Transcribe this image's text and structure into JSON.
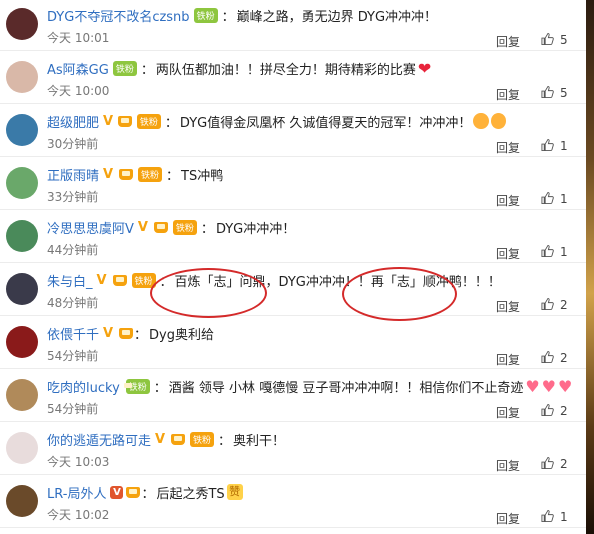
{
  "comments": [
    {
      "user": "DYG不夺冠不改名czsnb",
      "badge": "铁粉",
      "badge_color": "#8ec63f",
      "text": "巅峰之路，勇无边界 DYG冲冲冲！",
      "time": "今天 10:01",
      "reply": "回复",
      "likes": "5",
      "avatar_color": "#5a2a2a"
    },
    {
      "user": "As阿森GG",
      "badge": "铁粉",
      "badge_color": "#8ec63f",
      "text": "两队伍都加油！！拼尽全力！期待精彩的比赛",
      "time": "今天 10:00",
      "reply": "回复",
      "likes": "5",
      "avatar_color": "#d9b8a8"
    },
    {
      "user": "超级肥肥",
      "badge": "铁粉",
      "badge_color": "#f5a20e",
      "text": "DYG值得金凤凰杯 久诚值得夏天的冠军！冲冲冲！",
      "time": "30分钟前",
      "reply": "回复",
      "likes": "1",
      "avatar_color": "#3a7aa8"
    },
    {
      "user": "正版雨晴",
      "badge": "铁粉",
      "badge_color": "#f5a20e",
      "text": "TS冲鸭",
      "time": "33分钟前",
      "reply": "回复",
      "likes": "1",
      "avatar_color": "#6aa86a"
    },
    {
      "user": "冷思思思虞阿V",
      "badge": "铁粉",
      "badge_color": "#f5a20e",
      "text": "DYG冲冲冲！",
      "time": "44分钟前",
      "reply": "回复",
      "likes": "1",
      "avatar_color": "#4a8a5a"
    },
    {
      "user": "朱与白_",
      "badge": "铁粉",
      "badge_color": "#f5a20e",
      "text": "百炼「志」问鼎，DYG冲冲冲！！再「志」顺冲鸭！！！",
      "time": "48分钟前",
      "reply": "回复",
      "likes": "2",
      "avatar_color": "#3a3a4a"
    },
    {
      "user": "依偎千千",
      "badge": "",
      "badge_color": "#f5a20e",
      "text": "Dyg奥利给",
      "time": "54分钟前",
      "reply": "回复",
      "likes": "2",
      "avatar_color": "#8a1a1a"
    },
    {
      "user": "吃肉的lucky",
      "badge": "铁粉",
      "badge_color": "#8ec63f",
      "text": "酒酱 领导 小林 嘎德慢 豆子哥冲冲冲啊！！相信你们不止奇迹",
      "time": "54分钟前",
      "reply": "回复",
      "likes": "2",
      "avatar_color": "#b08a5a"
    },
    {
      "user": "你的逃遁无路可走",
      "badge": "铁粉",
      "badge_color": "#f5a20e",
      "text": "奥利干！",
      "time": "今天 10:03",
      "reply": "回复",
      "likes": "2",
      "avatar_color": "#e8dcdc"
    },
    {
      "user": "LR-局外人",
      "badge": "",
      "badge_color": "#f5a20e",
      "text": "后起之秀TS",
      "time": "今天 10:02",
      "reply": "回复",
      "likes": "1",
      "avatar_color": "#6a4a2a"
    }
  ],
  "colors": {
    "username": "#2f6ec0",
    "circle": "#d42a2a"
  }
}
